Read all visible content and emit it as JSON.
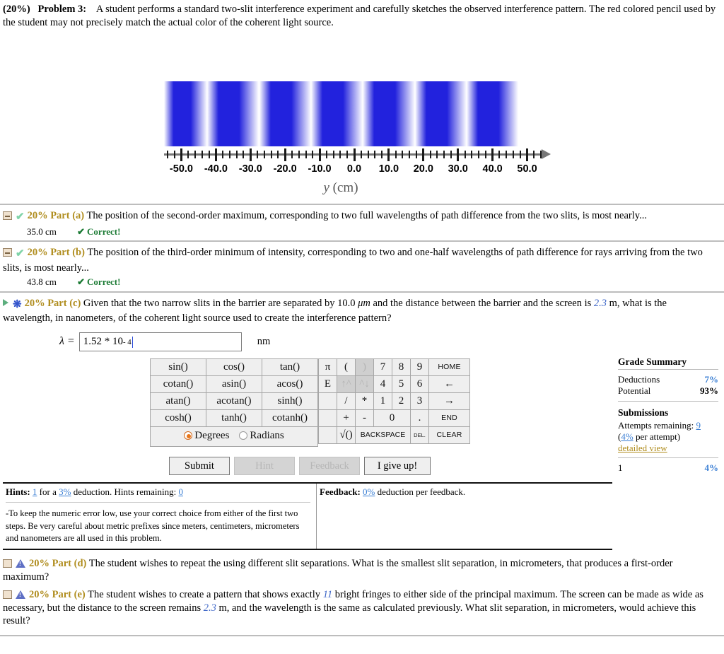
{
  "problem": {
    "percent": "(20%)",
    "label": "Problem 3:",
    "text": "A student performs a standard two-slit interference experiment and carefully sketches the observed interference pattern. The red colored pencil used by the student may not precisely match the actual color of the coherent light source."
  },
  "figure": {
    "axis_title_var": "y",
    "axis_title_unit": "(cm)",
    "tick_labels": [
      "-50.0",
      "-40.0",
      "-30.0",
      "-20.0",
      "-10.0",
      "0.0",
      "10.0",
      "20.0",
      "30.0",
      "40.0",
      "50.0"
    ],
    "fringe_color": "#2222dd",
    "fringe_centers_cm": [
      -50.0,
      -35.0,
      -20.0,
      -5.0,
      10.0,
      25.0,
      40.0
    ],
    "axis_min_cm": -55.0,
    "axis_max_cm": 55.0,
    "minor_tick_step_cm": 2.0,
    "major_tick_step_cm": 10.0
  },
  "parts": {
    "a": {
      "percent": "20%",
      "name": "Part (a)",
      "text": "The position of the second-order maximum, corresponding to two full wavelengths of path difference from the two slits, is most nearly...",
      "answer": "35.0 cm",
      "status": "Correct!"
    },
    "b": {
      "percent": "20%",
      "name": "Part (b)",
      "text": "The position of the third-order minimum of intensity, corresponding to two and one-half wavelengths of path difference for rays arriving from the two slits, is most nearly...",
      "answer": "43.8 cm",
      "status": "Correct!"
    },
    "c": {
      "percent": "20%",
      "name": "Part (c)",
      "text_1": "Given that the two narrow slits in the barrier are separated by 10.0 ",
      "text_mu": "μm",
      "text_2": " and the distance between the barrier and the screen is ",
      "distance": "2.3",
      "text_3": " m, what is the wavelength, in nanometers, of the coherent light source used to create the interference pattern?"
    },
    "d": {
      "percent": "20%",
      "name": "Part (d)",
      "text": "The student wishes to repeat the using different slit separations. What is the smallest slit separation, in micrometers, that produces a first-order maximum?"
    },
    "e": {
      "percent": "20%",
      "name": "Part (e)",
      "text_1": "The student wishes to create a pattern that shows exactly ",
      "fringes": "11",
      "text_2": " bright fringes to either side of the principal maximum. The screen can be made as wide as necessary, but the distance to the screen remains ",
      "distance": "2.3",
      "text_3": " m, and the wavelength is the same as calculated previously. What slit separation, in micrometers, would achieve this result?"
    }
  },
  "answer_entry": {
    "symbol": "λ =",
    "value_mantissa": "1.52 * 10",
    "value_exponent": "- 4",
    "unit": "nm"
  },
  "keypad": {
    "functions": [
      [
        "sin()",
        "cos()",
        "tan()"
      ],
      [
        "cotan()",
        "asin()",
        "acos()"
      ],
      [
        "atan()",
        "acotan()",
        "sinh()"
      ],
      [
        "cosh()",
        "tanh()",
        "cotanh()"
      ]
    ],
    "angle_modes": [
      "Degrees",
      "Radians"
    ],
    "angle_selected": "Degrees",
    "numpad": [
      [
        "π",
        "(",
        ")",
        "7",
        "8",
        "9",
        "HOME"
      ],
      [
        "E",
        "↑^",
        "^↓",
        "4",
        "5",
        "6",
        "←"
      ],
      [
        "",
        "/",
        "*",
        "1",
        "2",
        "3",
        "→"
      ],
      [
        "",
        "+",
        "-",
        "0",
        ".",
        "END"
      ],
      [
        "",
        "√()",
        "BACKSPACE",
        "DEL.",
        "CLEAR"
      ]
    ]
  },
  "buttons": {
    "submit": "Submit",
    "hint": "Hint",
    "feedback": "Feedback",
    "give_up": "I give up!"
  },
  "hints": {
    "title": "Hints:",
    "count": "1",
    "for_a": "for a",
    "deduction_pct": "3%",
    "deduction_text": "deduction. Hints remaining:",
    "remaining": "0",
    "body": "-To keep the numeric error low, use your correct choice from either of the first two steps. Be very careful about metric prefixes since meters, centimeters, micrometers and nanometers are all used in this problem."
  },
  "feedback": {
    "title": "Feedback:",
    "pct": "0%",
    "text": "deduction per feedback."
  },
  "grade_summary": {
    "title": "Grade Summary",
    "deductions_label": "Deductions",
    "deductions_value": "7%",
    "potential_label": "Potential",
    "potential_value": "93%",
    "submissions_title": "Submissions",
    "attempts_label": "Attempts remaining:",
    "attempts_value": "9",
    "per_attempt_pct": "4%",
    "per_attempt_text": "per attempt)",
    "detailed_view": "detailed view",
    "history_index": "1",
    "history_value": "4%"
  }
}
